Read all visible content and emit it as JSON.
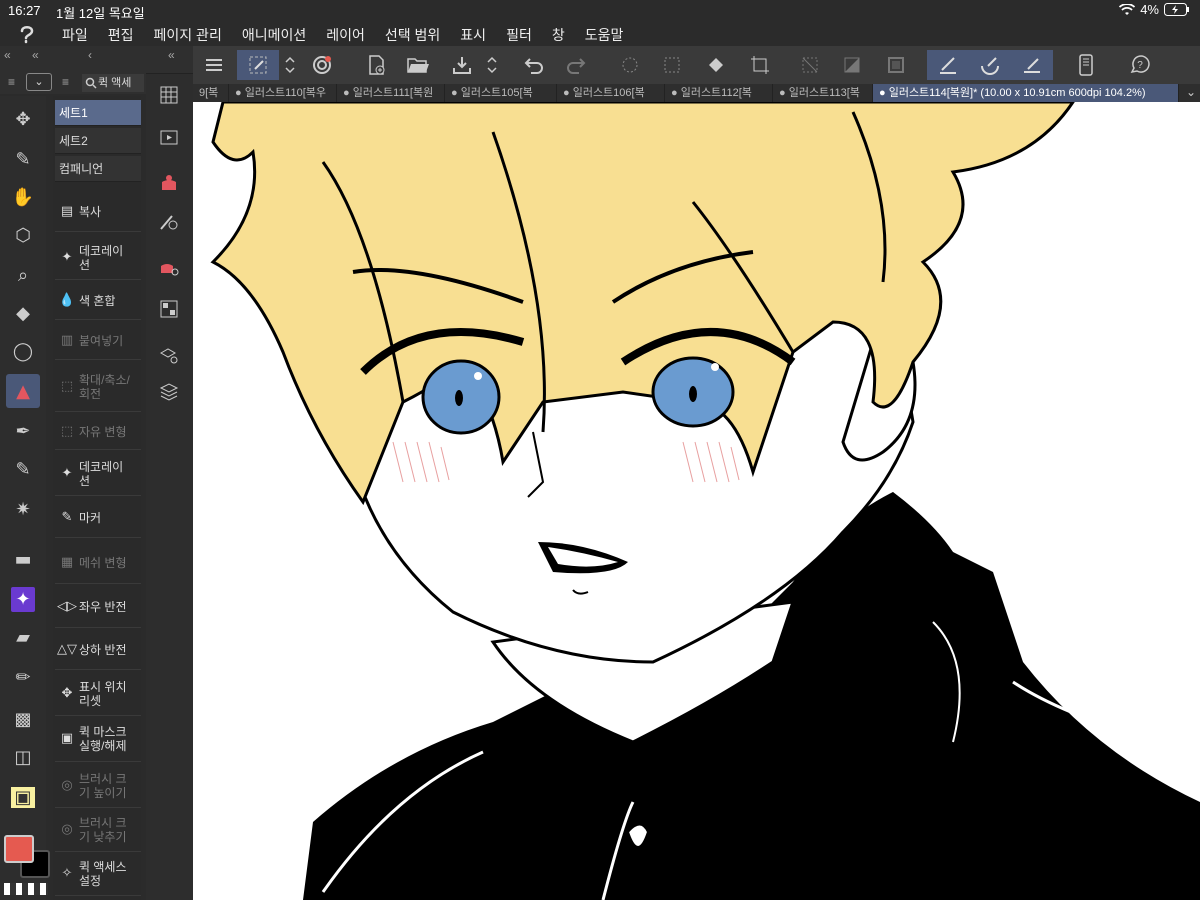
{
  "status": {
    "time": "16:27",
    "date": "1월 12일 목요일",
    "battery": "4%"
  },
  "menu": [
    "파일",
    "편집",
    "페이지 관리",
    "애니메이션",
    "레이어",
    "선택 범위",
    "표시",
    "필터",
    "창",
    "도움말"
  ],
  "left_header": {
    "quick_access_label": "퀵 액세"
  },
  "tabs": [
    {
      "label": "9[복"
    },
    {
      "label": "● 일러스트110[복우"
    },
    {
      "label": "● 일러스트111[복원"
    },
    {
      "label": "● 일러스트105[복"
    },
    {
      "label": "● 일러스트106[복"
    },
    {
      "label": "● 일러스트112[복"
    },
    {
      "label": "● 일러스트113[복"
    },
    {
      "label": "● 일러스트114[복원]* (10.00 x 10.91cm 600dpi 104.2%)"
    }
  ],
  "quick_sets": [
    {
      "label": "세트1"
    },
    {
      "label": "세트2"
    },
    {
      "label": "컴패니언"
    }
  ],
  "quick_items": [
    {
      "label": "복사",
      "enabled": true
    },
    {
      "label": "데코레이\n션",
      "enabled": true
    },
    {
      "label": "색 혼합",
      "enabled": true
    },
    {
      "label": "붙여넣기",
      "enabled": false
    },
    {
      "label": "확대/축소/\n회전",
      "enabled": false
    },
    {
      "label": "자유 변형",
      "enabled": false
    },
    {
      "label": "데코레이\n션",
      "enabled": true
    },
    {
      "label": "마커",
      "enabled": true
    },
    {
      "label": "메쉬 변형",
      "enabled": false
    },
    {
      "label": "좌우 반전",
      "enabled": true
    },
    {
      "label": "상하 반전",
      "enabled": true
    },
    {
      "label": "표시 위치\n리셋",
      "enabled": true
    },
    {
      "label": "퀵 마스크\n실행/해제",
      "enabled": true
    },
    {
      "label": "브러시 크\n기 높이기",
      "enabled": false
    },
    {
      "label": "브러시 크\n기 낮추기",
      "enabled": false
    },
    {
      "label": "퀵 액세스\n설정",
      "enabled": true
    }
  ],
  "colors": {
    "main": "#e55a50",
    "sub": "#000000",
    "accent": "#4a5878",
    "hair": "#f8df92",
    "eye": "#6a9bd0"
  },
  "icons": {
    "tools": [
      "move-icon",
      "pen-nib-icon",
      "hand-icon",
      "3d-cube-icon",
      "zoom-icon",
      "fill-icon",
      "lasso-icon",
      "brush-active-icon",
      "eyedropper-icon",
      "pen-icon",
      "sparkle-icon",
      "eraser-icon",
      "decoration-icon",
      "marker-icon",
      "pencil-icon",
      "gradient-icon",
      "blend-icon",
      "frame-icon"
    ]
  }
}
